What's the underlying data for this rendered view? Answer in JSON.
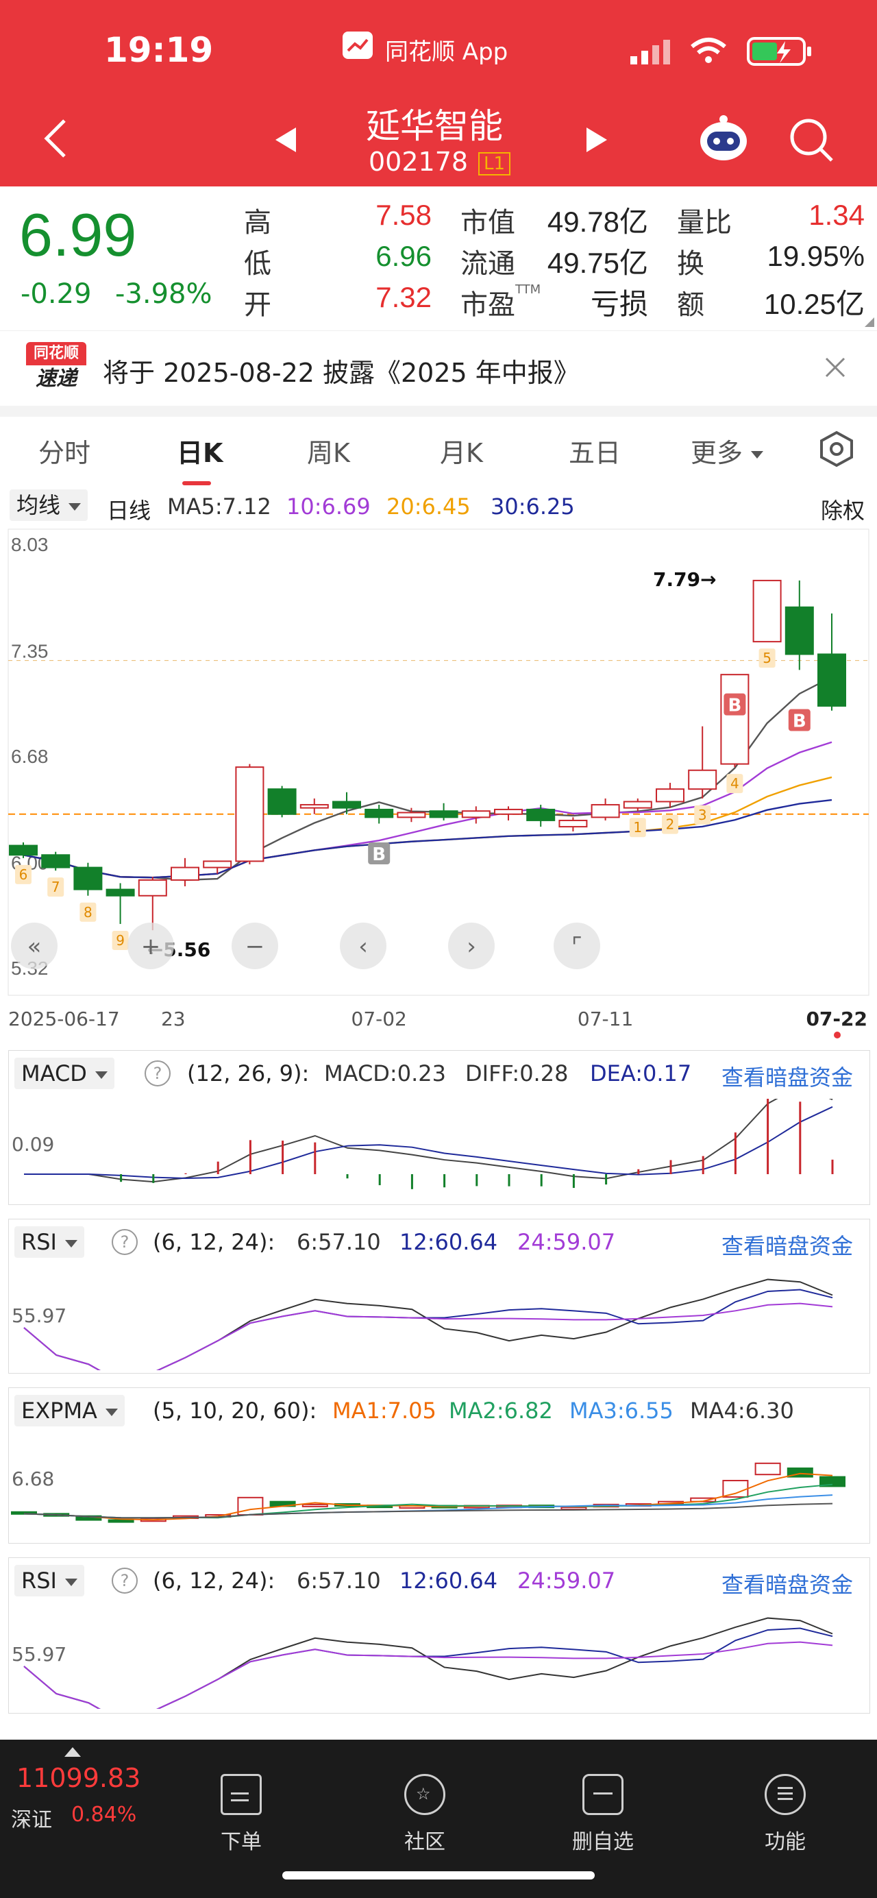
{
  "status_bar": {
    "time": "19:19",
    "app_name": "同花顺 App"
  },
  "header": {
    "stock_name": "延华智能",
    "stock_code": "002178",
    "level_badge": "L1"
  },
  "quote": {
    "price": "6.99",
    "change": "-0.29",
    "change_pct": "-3.98%",
    "high_label": "高",
    "high": "7.58",
    "low_label": "低",
    "low": "6.96",
    "open_label": "开",
    "open": "7.32",
    "mktcap_label": "市值",
    "mktcap": "49.78亿",
    "float_label": "流通",
    "float": "49.75亿",
    "pe_label": "市盈",
    "pe_sup": "TTM",
    "pe": "亏损",
    "vol_ratio_label": "量比",
    "vol_ratio": "1.34",
    "turnover_label": "换",
    "turnover": "19.95%",
    "amount_label": "额",
    "amount": "10.25亿"
  },
  "notice": {
    "badge_top": "同花顺",
    "badge_bottom": "速递",
    "text": "将于 2025-08-22 披露《2025 年中报》"
  },
  "tabs": [
    {
      "label": "分时"
    },
    {
      "label": "日K"
    },
    {
      "label": "周K"
    },
    {
      "label": "月K"
    },
    {
      "label": "五日"
    },
    {
      "label": "更多"
    }
  ],
  "kline": {
    "ma_selector": "均线",
    "period": "日线",
    "ma5": "MA5:7.12",
    "ma10": "10:6.69",
    "ma20": "20:6.45",
    "ma30": "30:6.25",
    "rights": "除权",
    "y_ticks": [
      "8.03",
      "7.35",
      "6.68",
      "6.00",
      "5.32"
    ],
    "high_mark": "7.79→",
    "low_mark": "←5.56",
    "x_ticks": [
      "2025-06-17",
      "23",
      "07-02",
      "07-11",
      "07-22"
    ]
  },
  "macd": {
    "name": "MACD",
    "params": "(12, 26, 9):",
    "macd": "MACD:0.23",
    "diff": "DIFF:0.28",
    "dea": "DEA:0.17",
    "link": "查看暗盘资金",
    "y_tick": "0.09"
  },
  "rsi1": {
    "name": "RSI",
    "params": "(6, 12, 24):",
    "r6": "6:57.10",
    "r12": "12:60.64",
    "r24": "24:59.07",
    "link": "查看暗盘资金",
    "y_tick": "55.97"
  },
  "expma": {
    "name": "EXPMA",
    "params": "(5, 10, 20, 60):",
    "ma1": "MA1:7.05",
    "ma2": "MA2:6.82",
    "ma3": "MA3:6.55",
    "ma4": "MA4:6.30",
    "y_tick": "6.68"
  },
  "rsi2": {
    "name": "RSI",
    "params": "(6, 12, 24):",
    "r6": "6:57.10",
    "r12": "12:60.64",
    "r24": "24:59.07",
    "link": "查看暗盘资金",
    "y_tick": "55.97"
  },
  "chart_data": {
    "type": "candlestick",
    "dates": [
      "06-17",
      "06-18",
      "06-19",
      "06-20",
      "06-23",
      "06-24",
      "06-25",
      "06-26",
      "06-27",
      "06-30",
      "07-01",
      "07-02",
      "07-03",
      "07-04",
      "07-07",
      "07-08",
      "07-09",
      "07-10",
      "07-11",
      "07-14",
      "07-15",
      "07-16",
      "07-17",
      "07-18",
      "07-21",
      "07-22"
    ],
    "ohlc": [
      [
        6.1,
        6.12,
        6.02,
        6.04
      ],
      [
        6.04,
        6.06,
        5.94,
        5.96
      ],
      [
        5.96,
        5.99,
        5.78,
        5.82
      ],
      [
        5.82,
        5.86,
        5.6,
        5.78
      ],
      [
        5.78,
        5.9,
        5.56,
        5.88
      ],
      [
        5.88,
        6.02,
        5.84,
        5.96
      ],
      [
        5.96,
        6.0,
        5.92,
        6.0
      ],
      [
        6.0,
        6.62,
        5.98,
        6.6
      ],
      [
        6.46,
        6.48,
        6.28,
        6.3
      ],
      [
        6.34,
        6.4,
        6.3,
        6.36
      ],
      [
        6.38,
        6.44,
        6.3,
        6.34
      ],
      [
        6.33,
        6.36,
        6.24,
        6.28
      ],
      [
        6.28,
        6.34,
        6.25,
        6.31
      ],
      [
        6.32,
        6.37,
        6.26,
        6.28
      ],
      [
        6.28,
        6.35,
        6.24,
        6.32
      ],
      [
        6.3,
        6.35,
        6.26,
        6.33
      ],
      [
        6.33,
        6.36,
        6.22,
        6.26
      ],
      [
        6.22,
        6.28,
        6.19,
        6.26
      ],
      [
        6.28,
        6.4,
        6.26,
        6.36
      ],
      [
        6.34,
        6.4,
        6.32,
        6.38
      ],
      [
        6.38,
        6.5,
        6.34,
        6.46
      ],
      [
        6.46,
        6.86,
        6.4,
        6.58
      ],
      [
        6.62,
        7.19,
        6.6,
        7.19
      ],
      [
        7.4,
        7.79,
        7.4,
        7.79
      ],
      [
        7.62,
        7.79,
        7.22,
        7.32
      ],
      [
        7.32,
        7.58,
        6.96,
        6.99
      ]
    ],
    "markers": {
      "1": "07-14",
      "2": "07-15",
      "3": "07-16",
      "4": "07-17",
      "5": "07-18",
      "6": "06-17",
      "7": "06-18",
      "8": "06-19",
      "9": "06-20"
    },
    "ma": {
      "MA5": 7.12,
      "MA10": 6.69,
      "MA20": 6.45,
      "MA30": 6.25
    },
    "y_range": [
      5.32,
      8.03
    ]
  },
  "bottom_bar": {
    "index_value": "11099.83",
    "index_name": "深证",
    "index_change": "0.84%",
    "items": [
      {
        "label": "下单"
      },
      {
        "label": "社区"
      },
      {
        "label": "删自选"
      },
      {
        "label": "功能"
      }
    ]
  }
}
